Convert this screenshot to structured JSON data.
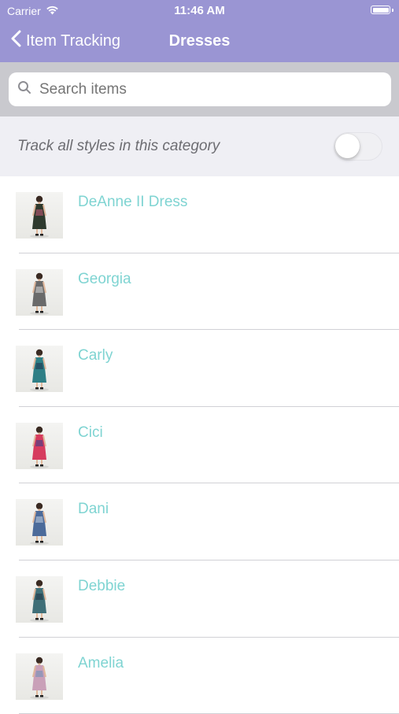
{
  "status_bar": {
    "carrier": "Carrier",
    "time": "11:46 AM"
  },
  "nav": {
    "back_label": "Item Tracking",
    "title": "Dresses"
  },
  "search": {
    "placeholder": "Search items",
    "value": ""
  },
  "track_all": {
    "label": "Track all styles in this category",
    "enabled": false
  },
  "items": [
    {
      "name": "DeAnne II Dress",
      "dress_color": "#2e3a2e",
      "accent_color": "#c85a7a"
    },
    {
      "name": "Georgia",
      "dress_color": "#6a6a6a",
      "accent_color": "#d9d9d9"
    },
    {
      "name": "Carly",
      "dress_color": "#2e7f86",
      "accent_color": "#1f2f4a"
    },
    {
      "name": "Cici",
      "dress_color": "#d63b5e",
      "accent_color": "#2e3f8f"
    },
    {
      "name": "Dani",
      "dress_color": "#4c6b9a",
      "accent_color": "#c7d3e3"
    },
    {
      "name": "Debbie",
      "dress_color": "#3f6f78",
      "accent_color": "#1f2f3f"
    },
    {
      "name": "Amelia",
      "dress_color": "#c9a0b8",
      "accent_color": "#6b8fb8"
    }
  ],
  "colors": {
    "header_bg": "#9a95d3",
    "item_text": "#7fd4d2",
    "track_row_bg": "#efeff4"
  }
}
